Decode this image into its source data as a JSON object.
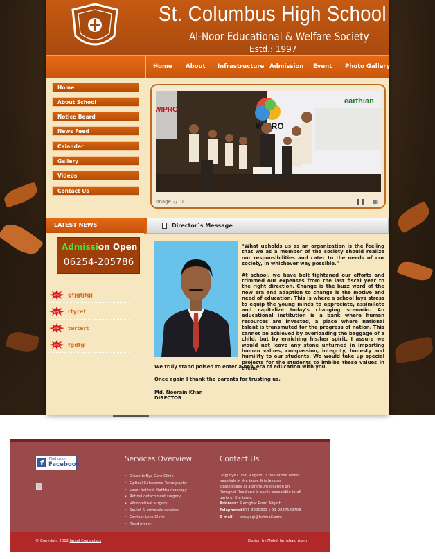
{
  "header": {
    "school_name": "St. Columbus High School",
    "society": "Al-Noor Educational & Welfare Society",
    "estd": "Estd.: 1997",
    "crest_text": "ST. COLUMBUS HIGH SCHOOL"
  },
  "nav": {
    "items": [
      "Home",
      "About",
      "Infrastructure",
      "Admission",
      "Event",
      "Photo Gallery"
    ]
  },
  "sidebar": {
    "items": [
      "Home",
      "About School",
      "Notice Board",
      "News Feed",
      "Calander",
      "Gallery",
      "Videos",
      "Contact Us"
    ]
  },
  "slider": {
    "caption": "Image 2/10",
    "pause_icon": "pause-icon",
    "grid_icon": "grid-icon",
    "banner_text": "WIPRO",
    "banner_sub": "earthian"
  },
  "latest_news": {
    "heading": "LATEST NEWS",
    "admission_prefix": "Admissi",
    "admission_suffix": "on Open",
    "admission_phone": "06254-205786",
    "items": [
      "gfjgfjfgj",
      "rtyret",
      "tertert",
      "fgdfg"
    ]
  },
  "director": {
    "heading": "Director`s Message",
    "paragraphs": [
      "\"What upholds us as an organization is the feeling that we as a member of the society should realize our responsibilities and cater to the needs of our society, in whichever way possible.\"",
      "At school, we have belt tightened our efforts and trimmed our expenses from the last fiscal year to the right direction. Change is the buzz word of the new era and adaption to change is the motive and need of education. This is where a school lays stress to equip the young minds to appreciate, assimilate and capitalize today's changing scenario. An educational institution is a bank where human resources are invested, a place where national talent is transmuted for the progress of nation. This cannot be achieved by overloading the baggage of a child, but by enriching his/her spirit. I assure we would not leave any stone unturned in imparting human values, compassion, integrity, honesty and humility to our students. We would take up special projects for the students to imbibe these values in them."
    ],
    "closing1": "We truly stand poised to enter a new era of education with you.",
    "closing2": "Once again I thank the parents for trusting us.",
    "name": "Md. Noorain Khan",
    "title": "DIRECTOR"
  },
  "footer": {
    "facebook_find": "Find us on",
    "facebook_name": "Facebook",
    "services_heading": "Services Overview",
    "services": [
      "Diabetic Eye Care Clinic",
      "Optical Coherence Tomography",
      "Laser Indirect Ophthalmoscopy",
      "Retinal detachment surgery",
      "Vitreoretinal surgery",
      "Squint & orthoptic services",
      "Contact Lens Clinic",
      "Read more»"
    ],
    "contact_heading": "Contact Us",
    "contact_desc": "Gogi Eye Clinic, Aligarh, is one of the oldest hospitals in the town. It is located strategically at a premium location on Ramghat Road and is easily accessible to all parts of the town.",
    "address_label": "Address:",
    "address_value": "Ramghat Road Aligarh",
    "telephone_label": "Telephone:",
    "telephone_value": "0571-3290303 +91-9837182798",
    "email_label": "E-mail:",
    "email_value": "enugogi@hotmail.com",
    "copyright_prefix": "© Copyright 2012",
    "copyright_link": "Jamal Computers",
    "design_by": "Design by Mohd. Jamshaid Alam"
  }
}
